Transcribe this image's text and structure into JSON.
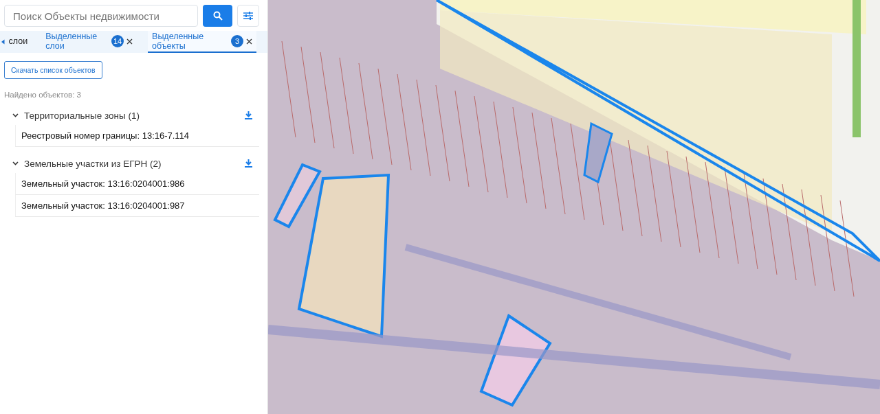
{
  "search": {
    "placeholder": "Поиск Объекты недвижимости"
  },
  "tabs": [
    {
      "label": "слои",
      "selected": false
    },
    {
      "label": "Выделенные слои",
      "count": "14",
      "selected": false
    },
    {
      "label": "Выделенные объекты",
      "count": "3",
      "selected": true
    }
  ],
  "download_button": "Скачать список объектов",
  "found_count": "Найдено объектов: 3",
  "groups": [
    {
      "title": "Территориальные зоны (1)",
      "expanded": true,
      "items": [
        "Реестровый номер границы: 13:16-7.114"
      ]
    },
    {
      "title": "Земельные участки из ЕГРН (2)",
      "expanded": true,
      "items": [
        "Земельный участок: 13:16:0204001:986",
        "Земельный участок: 13:16:0204001:987"
      ]
    }
  ]
}
